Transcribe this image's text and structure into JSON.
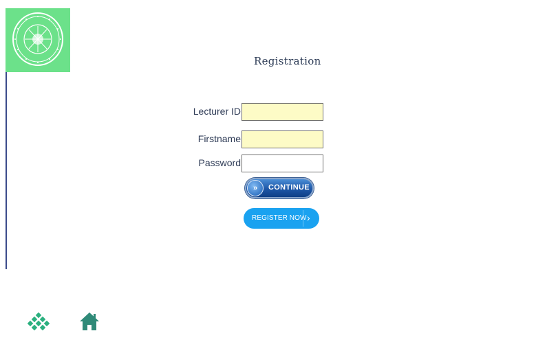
{
  "page": {
    "title": "Registration",
    "logo": {
      "name": "university-seal-logo",
      "bg_color": "#6ce18a"
    }
  },
  "form": {
    "lecturer_id": {
      "label": "Lecturer ID",
      "value": "",
      "bg": "#fdfbc6"
    },
    "firstname": {
      "label": "Firstname",
      "value": "",
      "bg": "#fdfbc6"
    },
    "password": {
      "label": "Password",
      "value": "",
      "bg": "#ffffff"
    }
  },
  "buttons": {
    "continue_label": "CONTINUE",
    "register_label": "REGISTER NOW",
    "register_color": "#1aa2f0"
  },
  "footer": {
    "icons": [
      {
        "name": "diamond-grid-icon",
        "color": "#2bb07f"
      },
      {
        "name": "home-icon",
        "color": "#2f8a78"
      }
    ]
  }
}
